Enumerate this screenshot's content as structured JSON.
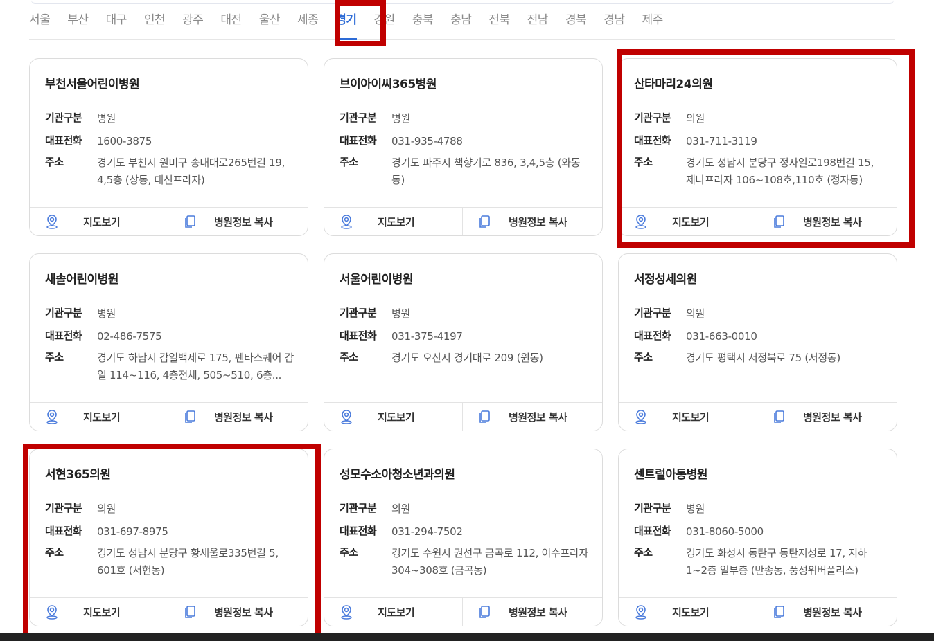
{
  "regions": [
    "서울",
    "부산",
    "대구",
    "인천",
    "광주",
    "대전",
    "울산",
    "세종",
    "경기",
    "강원",
    "충북",
    "충남",
    "전북",
    "전남",
    "경북",
    "경남",
    "제주"
  ],
  "active_region": "경기",
  "labels": {
    "type": "기관구분",
    "phone": "대표전화",
    "address": "주소",
    "map_button": "지도보기",
    "copy_button": "병원정보 복사"
  },
  "colors": {
    "accent": "#2d6bd6",
    "highlight": "#c00000"
  },
  "hospitals": [
    {
      "name": "부천서울어린이병원",
      "type": "병원",
      "phone": "1600-3875",
      "address": "경기도 부천시 원미구 송내대로265번길 19, 4,5층 (상동, 대신프라자)"
    },
    {
      "name": "브이아이씨365병원",
      "type": "병원",
      "phone": "031-935-4788",
      "address": "경기도 파주시 책향기로 836, 3,4,5층 (와동동)"
    },
    {
      "name": "산타마리24의원",
      "type": "의원",
      "phone": "031-711-3119",
      "address": "경기도 성남시 분당구 정자일로198번길 15, 제나프라자 106~108호,110호 (정자동)"
    },
    {
      "name": "새솔어린이병원",
      "type": "병원",
      "phone": "02-486-7575",
      "address": "경기도 하남시 감일백제로 175, 펜타스퀘어 감일 114~116, 4층전체, 505~510, 6층..."
    },
    {
      "name": "서울어린이병원",
      "type": "병원",
      "phone": "031-375-4197",
      "address": "경기도 오산시 경기대로 209 (원동)"
    },
    {
      "name": "서정성세의원",
      "type": "의원",
      "phone": "031-663-0010",
      "address": "경기도 평택시 서정북로 75 (서정동)"
    },
    {
      "name": "서현365의원",
      "type": "의원",
      "phone": "031-697-8975",
      "address": "경기도 성남시 분당구 황새울로335번길 5, 601호 (서현동)"
    },
    {
      "name": "성모수소아청소년과의원",
      "type": "의원",
      "phone": "031-294-7502",
      "address": "경기도 수원시 권선구 금곡로 112, 이수프라자 304~308호 (금곡동)"
    },
    {
      "name": "센트럴아동병원",
      "type": "병원",
      "phone": "031-8060-5000",
      "address": "경기도 화성시 동탄구 동탄지성로 17, 지하1~2층 일부층 (반송동, 풍성위버폴리스)"
    }
  ]
}
